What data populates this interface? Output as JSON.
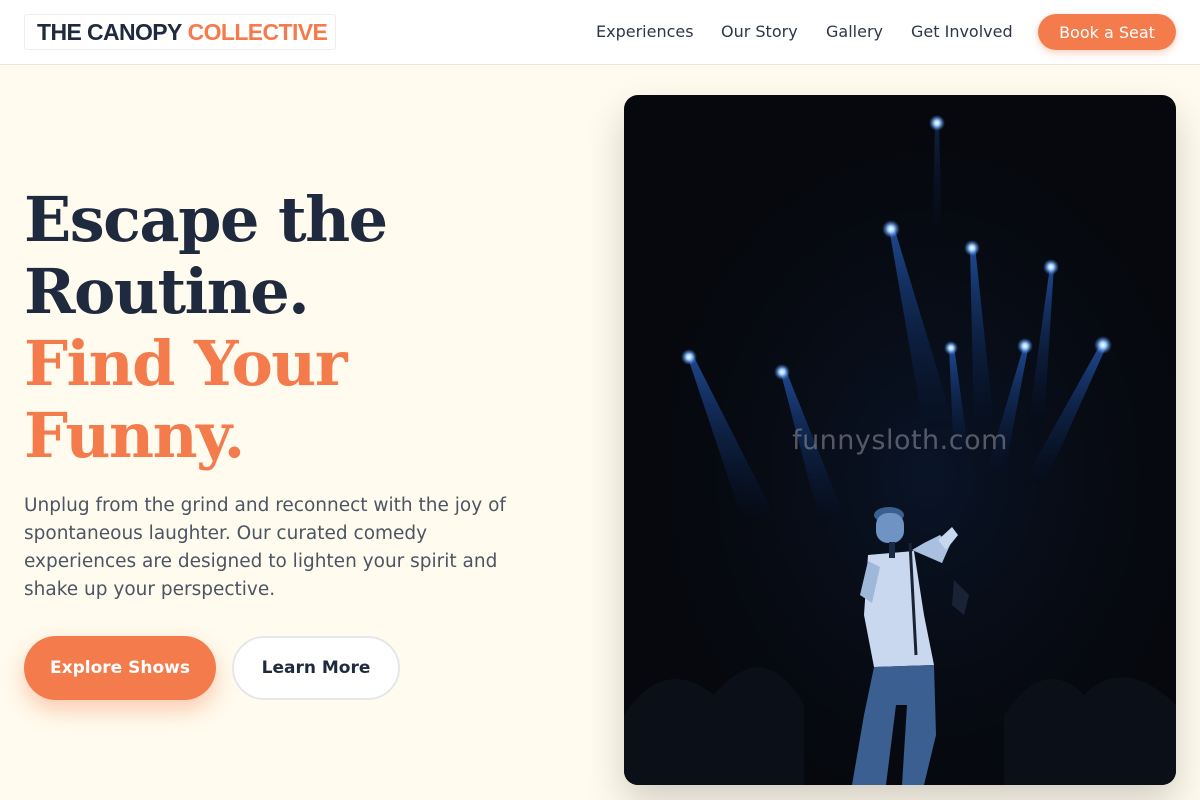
{
  "header": {
    "logo_dark": "THE CANOPY",
    "logo_accent": "COLLECTIVE",
    "nav": [
      "Experiences",
      "Our Story",
      "Gallery",
      "Get Involved"
    ],
    "cta": "Book a Seat"
  },
  "hero": {
    "headline_dark_1": "Escape the",
    "headline_dark_2": "Routine.",
    "headline_accent_1": "Find Your",
    "headline_accent_2": "Funny.",
    "description": "Unplug from the grind and reconnect with the joy of spontaneous laughter. Our curated comedy experiences are designed to lighten your spirit and shake up your perspective.",
    "primary_button": "Explore Shows",
    "secondary_button": "Learn More"
  },
  "image": {
    "watermark": "funnysloth.com"
  },
  "colors": {
    "accent": "#f47c4c",
    "navy": "#1f2a3f",
    "background": "#fffbee",
    "stage_light": "#5ea8ff"
  }
}
